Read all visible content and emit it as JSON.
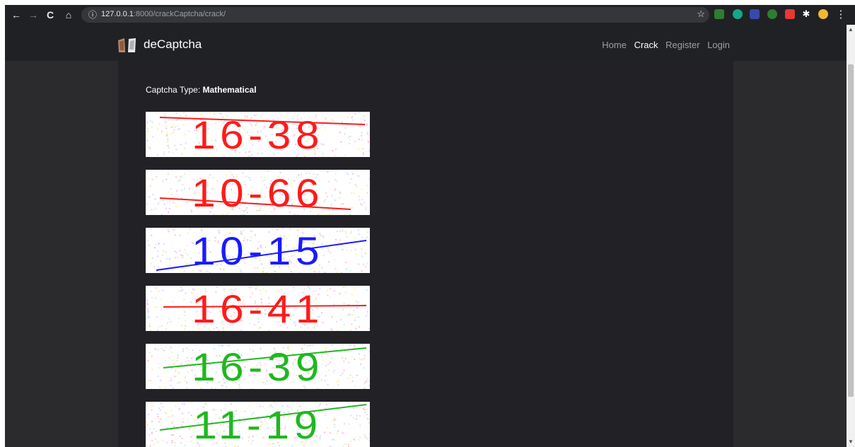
{
  "browser": {
    "url_host": "127.0.0.1",
    "url_rest": ":8000/crackCaptcha/crack/",
    "back_icon": "←",
    "forward_icon": "→",
    "reload_icon": "C",
    "home_icon": "⌂",
    "info_icon": "ⓘ",
    "star_icon": "☆",
    "menu_icon": "⋮"
  },
  "navbar": {
    "brand": "deCaptcha",
    "links": [
      "Home",
      "Crack",
      "Register",
      "Login"
    ],
    "active": "Crack"
  },
  "page": {
    "type_label": "Captcha Type: ",
    "type_value": "Mathematical"
  },
  "captchas": [
    {
      "text": "16-38",
      "color": "#ff1a1a"
    },
    {
      "text": "10-66",
      "color": "#ff1a1a"
    },
    {
      "text": "10-15",
      "color": "#1a1aff"
    },
    {
      "text": "16-41",
      "color": "#ff1a1a"
    },
    {
      "text": "16-39",
      "color": "#1fb81f"
    },
    {
      "text": "11-19",
      "color": "#1fb81f"
    }
  ]
}
